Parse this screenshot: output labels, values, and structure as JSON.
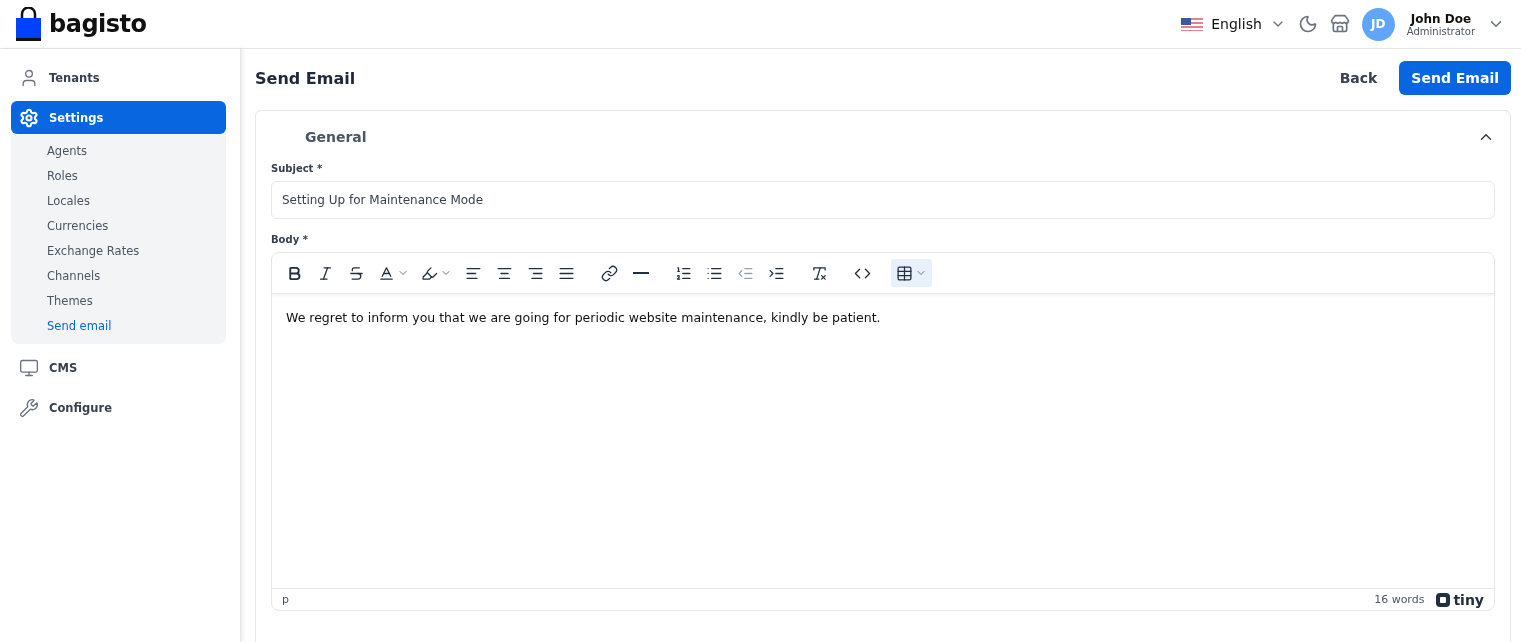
{
  "header": {
    "logo": "bagisto",
    "language": "English",
    "user": {
      "initials": "JD",
      "name": "John Doe",
      "role": "Administrator"
    }
  },
  "sidebar": {
    "items": [
      {
        "kind": "person",
        "label": "Tenants",
        "selected": false
      },
      {
        "kind": "gear",
        "label": "Settings",
        "selected": true,
        "children": [
          {
            "label": "Agents",
            "selected": false
          },
          {
            "label": "Roles",
            "selected": false
          },
          {
            "label": "Locales",
            "selected": false
          },
          {
            "label": "Currencies",
            "selected": false
          },
          {
            "label": "Exchange Rates",
            "selected": false
          },
          {
            "label": "Channels",
            "selected": false
          },
          {
            "label": "Themes",
            "selected": false
          },
          {
            "label": "Send email",
            "selected": true
          }
        ]
      },
      {
        "kind": "monitor",
        "label": "CMS",
        "selected": false
      },
      {
        "kind": "wrench",
        "label": "Configure",
        "selected": false
      }
    ]
  },
  "page": {
    "title": "Send Email",
    "back": "Back",
    "submit": "Send Email"
  },
  "card": {
    "title": "General",
    "expanded": true,
    "subject": {
      "label": "Subject *",
      "value": "Setting Up for Maintenance Mode"
    },
    "body": {
      "label": "Body *",
      "text": "We regret to inform you that we are going for periodic website maintenance, kindly be patient.",
      "path": "p",
      "word_count": "16 words",
      "brand": "tiny",
      "toolbar": [
        [
          {
            "kind": "bold",
            "disabled": false,
            "active": false
          },
          {
            "kind": "italic",
            "disabled": false,
            "active": false
          },
          {
            "kind": "strike",
            "disabled": false,
            "active": false
          },
          {
            "kind": "forecolor",
            "disabled": false,
            "active": false
          },
          {
            "kind": "highlight",
            "disabled": false,
            "active": false
          },
          {
            "kind": "alignleft",
            "disabled": false,
            "active": false
          },
          {
            "kind": "aligncenter",
            "disabled": false,
            "active": false
          },
          {
            "kind": "alignright",
            "disabled": false,
            "active": false
          },
          {
            "kind": "justify",
            "disabled": false,
            "active": false
          }
        ],
        [
          {
            "kind": "link",
            "disabled": false,
            "active": false
          },
          {
            "kind": "hr",
            "disabled": false,
            "active": false
          }
        ],
        [
          {
            "kind": "numlist",
            "disabled": false,
            "active": false
          },
          {
            "kind": "bullist",
            "disabled": false,
            "active": false
          },
          {
            "kind": "outdent",
            "disabled": true,
            "active": false
          },
          {
            "kind": "indent",
            "disabled": false,
            "active": false
          }
        ],
        [
          {
            "kind": "clear",
            "disabled": false,
            "active": false
          }
        ],
        [
          {
            "kind": "code",
            "disabled": false,
            "active": false
          }
        ],
        [
          {
            "kind": "table",
            "disabled": false,
            "active": true
          }
        ]
      ]
    }
  }
}
